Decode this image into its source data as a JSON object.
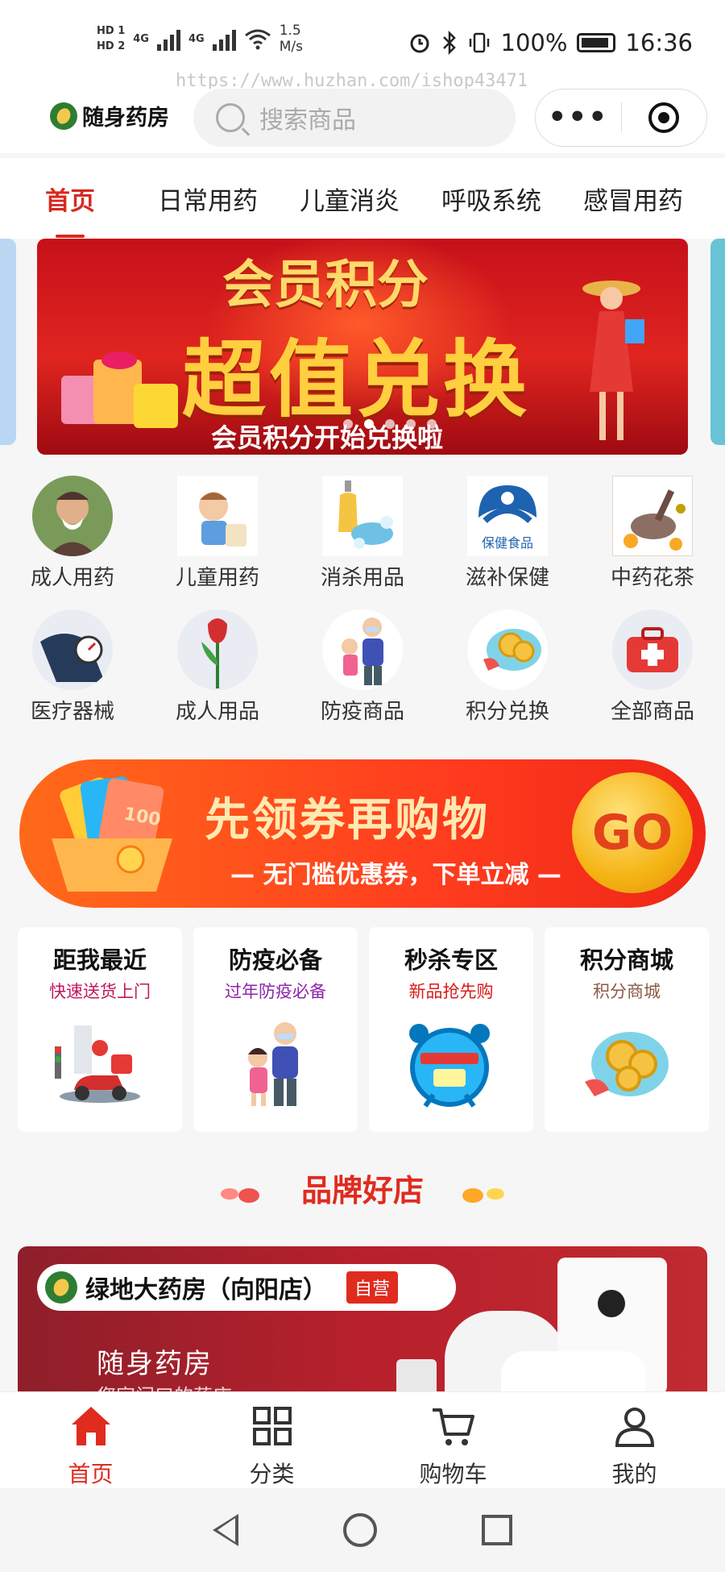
{
  "status_bar": {
    "hd1": "HD 1",
    "hd2": "HD 2",
    "net1": "4G",
    "net2": "4G",
    "speed_value": "1.5",
    "speed_unit": "M/s",
    "battery": "100%",
    "time": "16:36"
  },
  "watermark": "https://www.huzhan.com/ishop43471",
  "header": {
    "logo_text": "随身药房",
    "search_placeholder": "搜索商品",
    "more_icon": "more-dots-icon",
    "target_icon": "target-icon"
  },
  "tabs": [
    {
      "label": "首页",
      "active": true
    },
    {
      "label": "日常用药",
      "active": false
    },
    {
      "label": "儿童消炎",
      "active": false
    },
    {
      "label": "呼吸系统",
      "active": false
    },
    {
      "label": "感冒用药",
      "active": false
    }
  ],
  "banner": {
    "line1": "会员积分",
    "line2": "超值兑换",
    "line3": "会员积分开始兑换啦",
    "active_dot": 1,
    "dot_count": 5
  },
  "categories": [
    {
      "label": "成人用药",
      "icon": "sneezing-man-icon"
    },
    {
      "label": "儿童用药",
      "icon": "sick-child-icon"
    },
    {
      "label": "消杀用品",
      "icon": "soap-icon"
    },
    {
      "label": "滋补保健",
      "icon": "health-food-icon"
    },
    {
      "label": "中药花茶",
      "icon": "herbal-tea-icon"
    },
    {
      "label": "医疗器械",
      "icon": "blood-pressure-icon"
    },
    {
      "label": "成人用品",
      "icon": "tulip-icon"
    },
    {
      "label": "防疫商品",
      "icon": "masked-family-icon"
    },
    {
      "label": "积分兑换",
      "icon": "coins-icon"
    },
    {
      "label": "全部商品",
      "icon": "first-aid-kit-icon"
    }
  ],
  "health_food_badge": "保健食品",
  "coupon": {
    "title": "先领券再购物",
    "subtitle": "— 无门槛优惠券，下单立减 —",
    "go_label": "GO",
    "card_amount": "100"
  },
  "feature_cards": [
    {
      "title": "距我最近",
      "subtitle": "快速送货上门",
      "subtitle_color": "#c2185b",
      "icon": "delivery-scooter-icon"
    },
    {
      "title": "防疫必备",
      "subtitle": "过年防疫必备",
      "subtitle_color": "#8e24aa",
      "icon": "masked-family-icon"
    },
    {
      "title": "秒杀专区",
      "subtitle": "新品抢先购",
      "subtitle_color": "#d81b1b",
      "icon": "alarm-clock-icon"
    },
    {
      "title": "积分商城",
      "subtitle": "积分商城",
      "subtitle_color": "#8a5a44",
      "icon": "coins-icon"
    }
  ],
  "brand_section_title": "品牌好店",
  "shop": {
    "name": "绿地大药房（向阳店）",
    "tag": "自营",
    "slogan": "随身药房",
    "slogan2": "您家门口的药店"
  },
  "bottom_nav": [
    {
      "label": "首页",
      "icon": "home-icon",
      "active": true
    },
    {
      "label": "分类",
      "icon": "grid-icon",
      "active": false
    },
    {
      "label": "购物车",
      "icon": "cart-icon",
      "active": false
    },
    {
      "label": "我的",
      "icon": "user-icon",
      "active": false
    }
  ],
  "colors": {
    "accent": "#e02b1f",
    "coupon_gold": "#f5b313",
    "logo_green": "#2e7d32"
  }
}
